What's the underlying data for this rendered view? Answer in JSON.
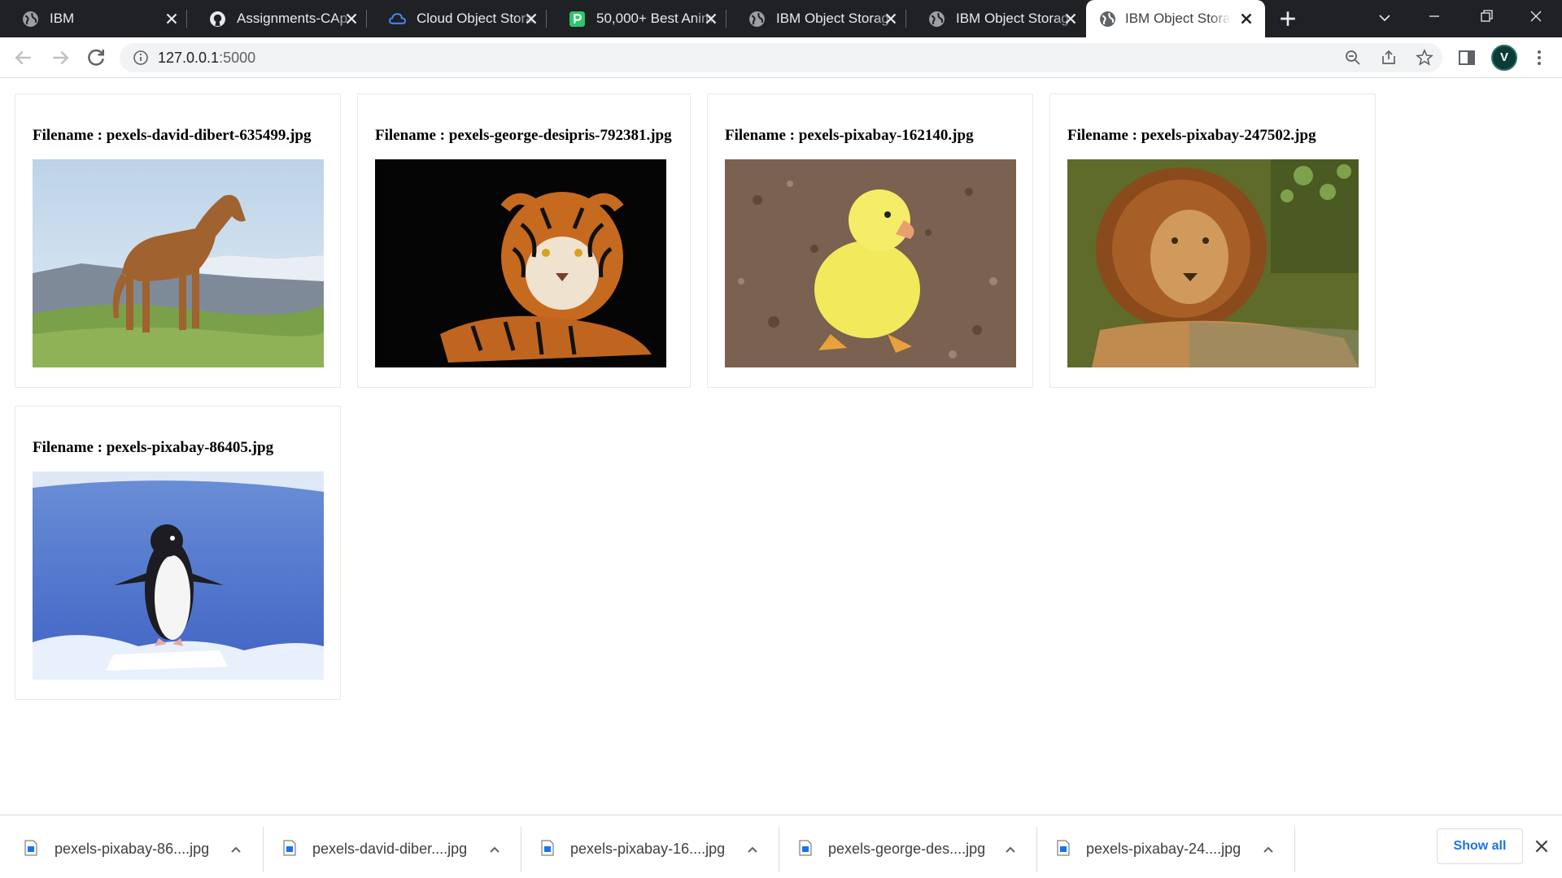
{
  "browser": {
    "tabs": [
      {
        "title": "IBM",
        "icon": "globe-icon"
      },
      {
        "title": "Assignments-CAp",
        "icon": "github-icon"
      },
      {
        "title": "Cloud Object Stora",
        "icon": "cloud-icon"
      },
      {
        "title": "50,000+ Best Anim",
        "icon": "pixabay-icon"
      },
      {
        "title": "IBM Object Storag",
        "icon": "globe-icon"
      },
      {
        "title": "IBM Object Storag",
        "icon": "globe-icon"
      },
      {
        "title": "IBM Object Storag",
        "icon": "globe-icon",
        "active": true
      }
    ],
    "url_host": "127.0.0.1",
    "url_port": ":5000",
    "profile_initial": "V"
  },
  "gallery": [
    {
      "label": "Filename : pexels-david-dibert-635499.jpg",
      "subject": "horse"
    },
    {
      "label": "Filename : pexels-george-desipris-792381.jpg",
      "subject": "tiger"
    },
    {
      "label": "Filename : pexels-pixabay-162140.jpg",
      "subject": "duckling"
    },
    {
      "label": "Filename : pexels-pixabay-247502.jpg",
      "subject": "lion"
    },
    {
      "label": "Filename : pexels-pixabay-86405.jpg",
      "subject": "penguin"
    }
  ],
  "downloads": {
    "items": [
      "pexels-pixabay-86....jpg",
      "pexels-david-diber....jpg",
      "pexels-pixabay-16....jpg",
      "pexels-george-des....jpg",
      "pexels-pixabay-24....jpg"
    ],
    "show_all": "Show all"
  },
  "colors": {
    "tabstrip_bg": "#202124",
    "link_blue": "#1a73e8"
  }
}
